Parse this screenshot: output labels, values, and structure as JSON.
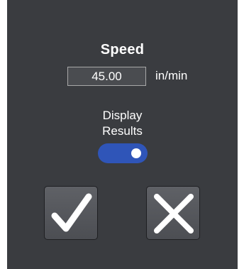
{
  "dialog": {
    "title": "Speed",
    "speed_value": "45.00",
    "speed_unit": "in/min",
    "toggle_label_line1": "Display",
    "toggle_label_line2": "Results",
    "toggle_on": true
  },
  "icons": {
    "ok": "checkmark-icon",
    "cancel": "close-icon"
  },
  "colors": {
    "background": "#3a3c40",
    "toggle_accent": "#2f55b8",
    "button_face": "#55575c"
  }
}
